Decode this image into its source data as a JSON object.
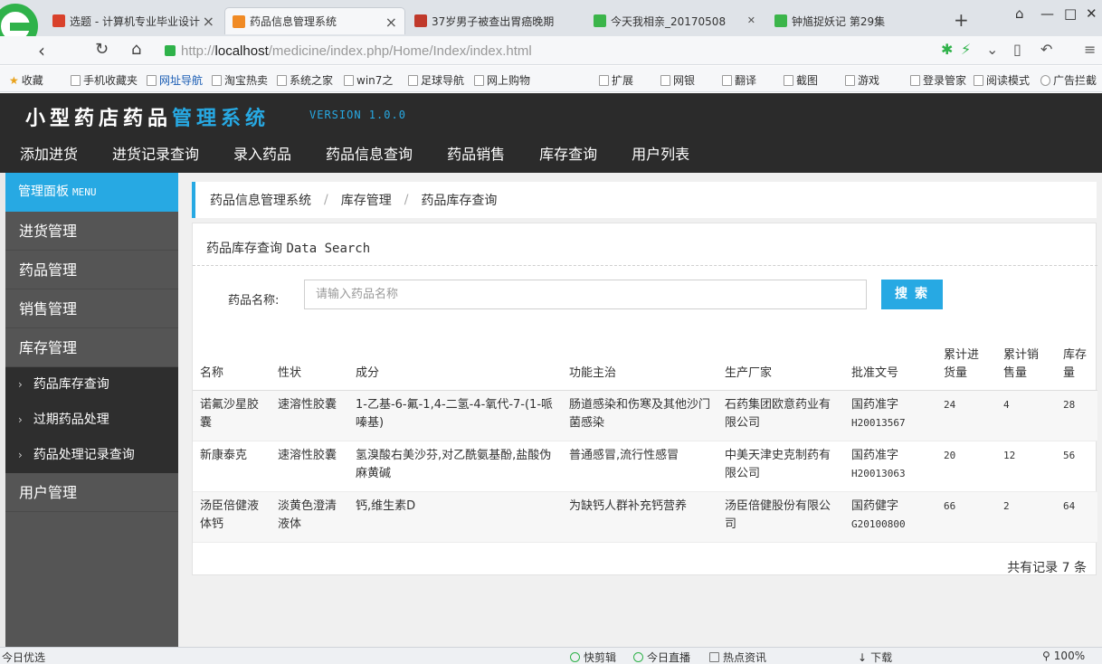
{
  "browser": {
    "tabs": [
      {
        "title": "选题 - 计算机专业毕业设计",
        "favicon_color": "#d9412b",
        "active": false
      },
      {
        "title": "药品信息管理系统",
        "favicon_color": "#f08a24",
        "active": true
      },
      {
        "title": "37岁男子被查出胃癌晚期",
        "favicon_color": "#c0392b",
        "active": false
      },
      {
        "title": "今天我相亲_20170508",
        "favicon_color": "#3bb54a",
        "active": false
      },
      {
        "title": "钟馗捉妖记 第29集",
        "favicon_color": "#3bb54a",
        "active": false
      }
    ],
    "url_prefix": "http://",
    "url_host": "localhost",
    "url_path": "/medicine/index.php/Home/Index/index.html",
    "bookmarks": [
      "收藏",
      "手机收藏夹",
      "网址导航",
      "淘宝热卖",
      "系统之家",
      "win7之",
      "足球导航",
      "网上购物"
    ],
    "toolbar_right": [
      "扩展",
      "网银",
      "翻译",
      "截图",
      "游戏",
      "登录管家",
      "阅读模式",
      "广告拦截"
    ]
  },
  "app": {
    "title_main": "小型药店药品",
    "title_accent": "管理系统",
    "version": "VERSION 1.0.0",
    "top_menu": [
      "添加进货",
      "进货记录查询",
      "录入药品",
      "药品信息查询",
      "药品销售",
      "库存查询",
      "用户列表"
    ]
  },
  "sidebar": {
    "header": "管理面板",
    "header_en": "MENU",
    "items": [
      "进货管理",
      "药品管理",
      "销售管理",
      "库存管理"
    ],
    "sub_items": [
      "药品库存查询",
      "过期药品处理",
      "药品处理记录查询"
    ],
    "last_item": "用户管理"
  },
  "breadcrumb": [
    "药品信息管理系统",
    "库存管理",
    "药品库存查询"
  ],
  "panel": {
    "title": "药品库存查询",
    "title_en": "Data Search",
    "search_label": "药品名称:",
    "search_placeholder": "请输入药品名称",
    "search_button": "搜索",
    "record_count": "共有记录 7 条"
  },
  "table": {
    "headers": [
      "名称",
      "性状",
      "成分",
      "功能主治",
      "生产厂家",
      "批准文号",
      "累计进货量",
      "累计销售量",
      "库存量"
    ],
    "rows": [
      {
        "name": "诺氟沙星胶囊",
        "form": "速溶性胶囊",
        "ingredients": "1-乙基-6-氟-1,4-二氢-4-氧代-7-(1-哌嗪基)",
        "indications": "肠道感染和伤寒及其他沙门菌感染",
        "manufacturer": "石药集团欧意药业有限公司",
        "approval_label": "国药准字",
        "approval_no": "H20013567",
        "purchased": "24",
        "sold": "4",
        "stock": "28"
      },
      {
        "name": "新康泰克",
        "form": "速溶性胶囊",
        "ingredients": "氢溴酸右美沙芬,对乙酰氨基酚,盐酸伪麻黄碱",
        "indications": "普通感冒,流行性感冒",
        "manufacturer": "中美天津史克制药有限公司",
        "approval_label": "国药准字",
        "approval_no": "H20013063",
        "purchased": "20",
        "sold": "12",
        "stock": "56"
      },
      {
        "name": "汤臣倍健液体钙",
        "form": "淡黄色澄清液体",
        "ingredients": "钙,维生素D",
        "indications": "为缺钙人群补充钙营养",
        "manufacturer": "汤臣倍健股份有限公司",
        "approval_label": "国药健字",
        "approval_no": "G20100800",
        "purchased": "66",
        "sold": "2",
        "stock": "64"
      }
    ]
  },
  "statusbar": {
    "left": "今日优选",
    "items": [
      "快剪辑",
      "今日直播",
      "热点资讯",
      "下载",
      "100%"
    ]
  },
  "colors": {
    "accent": "#27a9e3",
    "header_bg": "#2b2b2b",
    "sidebar_bg": "#555555",
    "sidebar_sub_bg": "#2e2e2e"
  }
}
